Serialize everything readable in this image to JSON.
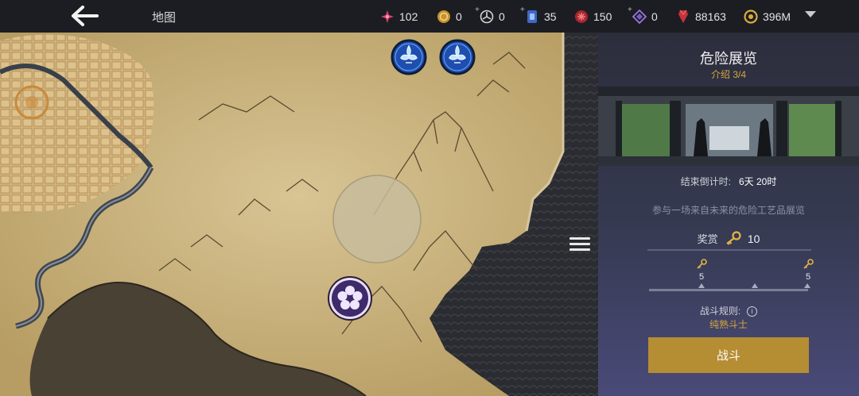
{
  "header": {
    "back_icon": "arrow-left-icon",
    "title": "地图",
    "resources": [
      {
        "name": "pink-crystal",
        "icon": "pink-star-icon",
        "value": "102",
        "plus": false
      },
      {
        "name": "gold-token",
        "icon": "gold-coin-icon",
        "value": "0",
        "plus": false
      },
      {
        "name": "silver-token",
        "icon": "silver-coin-icon",
        "value": "0",
        "plus": true
      },
      {
        "name": "blue-card",
        "icon": "blue-card-icon",
        "value": "35",
        "plus": true
      },
      {
        "name": "red-token",
        "icon": "red-token-icon",
        "value": "150",
        "plus": false
      },
      {
        "name": "purple-gem",
        "icon": "purple-diamond-icon",
        "value": "0",
        "plus": true
      },
      {
        "name": "red-crystal",
        "icon": "red-crystal-icon",
        "value": "88163",
        "plus": false
      },
      {
        "name": "gold-currency",
        "icon": "gold-ring-icon",
        "value": "396M",
        "plus": false
      }
    ]
  },
  "map": {
    "markers": [
      {
        "name": "blue-fleur-marker-1",
        "icon": "fleur-de-lis-icon"
      },
      {
        "name": "blue-fleur-marker-2",
        "icon": "fleur-de-lis-icon"
      },
      {
        "name": "purple-flower-marker",
        "icon": "flower-icon"
      }
    ],
    "menu_icon": "hamburger-menu-icon"
  },
  "panel": {
    "title": "危险展览",
    "subtitle": "介绍 3/4",
    "countdown_label": "结束倒计时:",
    "countdown_value": "6天 20时",
    "description": "参与一场来自未来的危险工艺品展览",
    "reward_label": "奖赏",
    "reward_value": "10",
    "reward_icon": "key-icon",
    "milestones": [
      {
        "value": "5",
        "icon": "key-icon"
      },
      {
        "value": "5",
        "icon": "key-icon"
      }
    ],
    "rules_label": "战斗规则:",
    "rules_value": "纯熟斗士",
    "battle_label": "战斗"
  },
  "colors": {
    "accent_gold": "#d7a640",
    "button_gold": "#b58d33",
    "panel_dark": "#2c2e3c",
    "map_parchment": "#c9b47e"
  }
}
